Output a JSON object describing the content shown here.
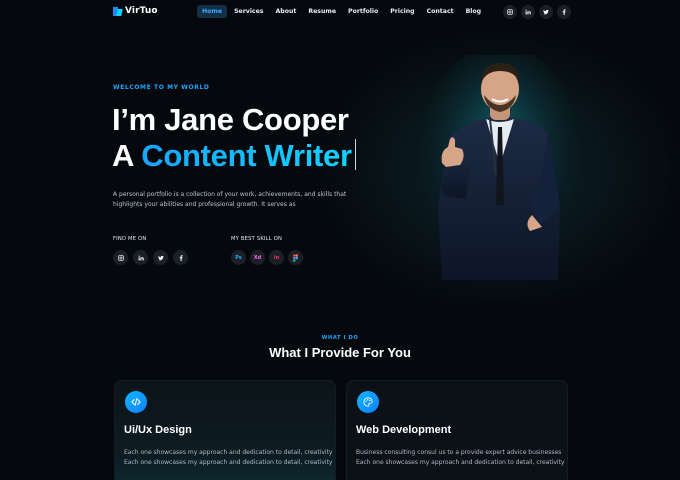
{
  "brand": {
    "name": "VirTuo"
  },
  "nav": {
    "items": [
      "Home",
      "Services",
      "About",
      "Resume",
      "Portfolio",
      "Pricing",
      "Contact",
      "Blog"
    ],
    "active": "Home"
  },
  "header_socials": [
    "instagram-icon",
    "linkedin-icon",
    "twitter-icon",
    "facebook-icon"
  ],
  "hero": {
    "kicker": "WELCOME TO MY WORLD",
    "title_line1": "I’m Jane Cooper",
    "title_line2_prefix": "A ",
    "title_line2_highlight": "Content Writer",
    "description": "A personal portfolio is a collection of your work, achievements, and skills that highlights your abilities and professional growth. It serves as",
    "find_me_label": "FIND ME ON",
    "best_skill_label": "MY BEST SKILL ON",
    "socials": [
      "instagram-icon",
      "linkedin-icon",
      "twitter-icon",
      "facebook-icon"
    ],
    "skills": [
      {
        "icon": "photoshop-icon",
        "text": "Ps",
        "color": "#31a8ff"
      },
      {
        "icon": "xd-icon",
        "text": "Xd",
        "color": "#ff61f6"
      },
      {
        "icon": "invision-icon",
        "text": "in",
        "color": "#ff3366"
      },
      {
        "icon": "figma-icon",
        "text": "",
        "color": "#f24e1e"
      }
    ]
  },
  "services": {
    "kicker": "WHAT I DO",
    "title": "What I Provide For You",
    "cards": [
      {
        "icon": "code-icon",
        "title": "Ui/Ux Design",
        "text": "Each one showcases my approach and dedication to detail, creativity Each one showcases my approach and dedication to detail, creativity"
      },
      {
        "icon": "palette-icon",
        "title": "Web Development",
        "text": "Business consulting consul us to a provide expert advice businesses Each one showcases my approach and dedication to detail, creativity"
      }
    ]
  },
  "colors": {
    "accent": "#17a6ff",
    "accent2": "#10d4ff",
    "background": "#05090d",
    "nav_active_bg": "#123046"
  }
}
